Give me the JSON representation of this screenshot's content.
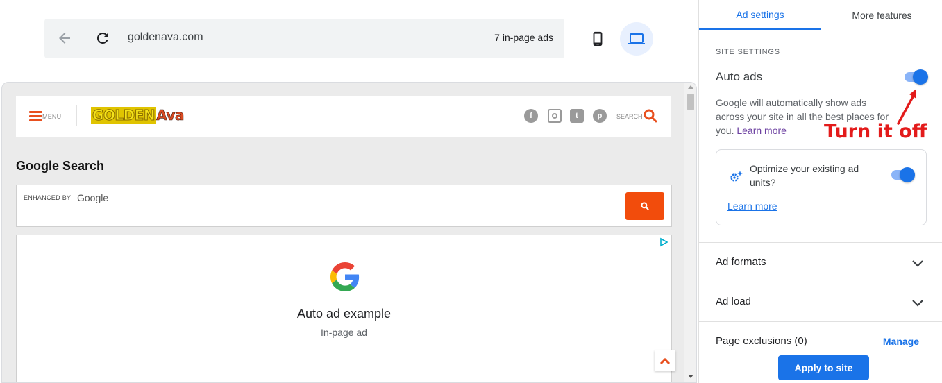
{
  "toolbar": {
    "url": "goldenava.com",
    "ad_count": "7 in-page ads",
    "back_icon": "arrow-back-icon",
    "reload_icon": "reload-icon",
    "mobile_icon": "phone-icon",
    "desktop_icon": "laptop-icon"
  },
  "preview": {
    "site_header": {
      "menu_label": "MENU",
      "logo_part1": "GOLDEN",
      "logo_part2": "Ava",
      "social_icons": [
        "facebook-icon",
        "instagram-icon",
        "twitter-icon",
        "pinterest-icon"
      ],
      "search_label": "SEARCH"
    },
    "google_search": {
      "title": "Google Search",
      "enhanced_by": "ENHANCED BY",
      "google_word": "Google"
    },
    "ad_example": {
      "title": "Auto ad example",
      "subtitle": "In-page ad"
    }
  },
  "panel": {
    "tabs": [
      {
        "label": "Ad settings",
        "active": true
      },
      {
        "label": "More features",
        "active": false
      }
    ],
    "section_label": "SITE SETTINGS",
    "auto_ads": {
      "label": "Auto ads",
      "enabled": true,
      "description": "Google will automatically show ads across your site in all the best places for you.",
      "learn_more": "Learn more"
    },
    "annotation": "Turn it off",
    "optimize": {
      "text": "Optimize your existing ad units?",
      "enabled": true,
      "learn_more": "Learn more"
    },
    "rows": {
      "ad_formats": "Ad formats",
      "ad_load": "Ad load",
      "page_exclusions": "Page exclusions (0)",
      "manage": "Manage"
    },
    "apply_button": "Apply to site"
  },
  "colors": {
    "accent": "#1a73e8",
    "annotation": "#e31b1b",
    "search_button": "#f24c0c"
  }
}
